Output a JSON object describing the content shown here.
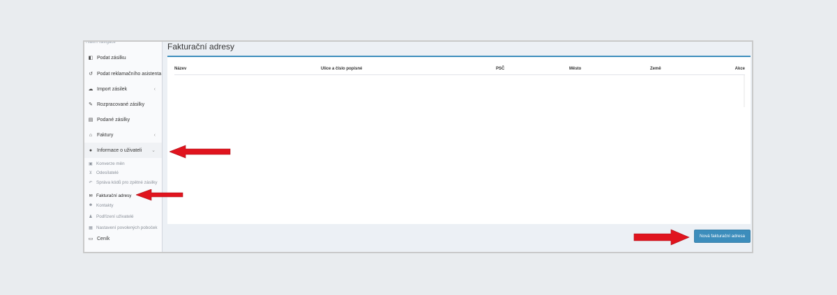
{
  "sidebar": {
    "nav_header": "Hlavní navigace",
    "items": [
      {
        "label": "Podat zásilku",
        "icon": "box-icon"
      },
      {
        "label": "Podat reklamačního asistenta",
        "icon": "undo-icon"
      },
      {
        "label": "Import zásilek",
        "icon": "cloud-upload-icon",
        "chevron": "‹"
      },
      {
        "label": "Rozpracované zásilky",
        "icon": "edit-icon"
      },
      {
        "label": "Podané zásilky",
        "icon": "inbox-icon"
      },
      {
        "label": "Faktury",
        "icon": "bank-icon",
        "chevron": "‹"
      },
      {
        "label": "Informace o uživateli",
        "icon": "user-icon",
        "chevron": "⌄"
      }
    ],
    "sub_items": [
      {
        "label": "Konverze měn",
        "icon": "money-icon"
      },
      {
        "label": "Odesílatelé",
        "icon": "cart-icon"
      },
      {
        "label": "Správa kódů pro zpětné zásilky",
        "icon": "reply-icon"
      },
      {
        "label": "Fakturační adresy",
        "icon": "envelope-icon"
      },
      {
        "label": "Kontakty",
        "icon": "users-icon"
      },
      {
        "label": "Podřízení uživatelé",
        "icon": "person-icon"
      },
      {
        "label": "Nastavení povolených poboček",
        "icon": "grid-icon"
      }
    ],
    "last_item": {
      "label": "Ceník",
      "icon": "credit-card-icon"
    }
  },
  "main": {
    "title": "Fakturační adresy",
    "table_headers": [
      "Název",
      "Ulice a číslo popisné",
      "PSČ",
      "Město",
      "Země",
      "Akce"
    ],
    "new_button_label": "Nová fakturační adresa"
  },
  "colors": {
    "accent": "#3c8dbc",
    "arrow": "#e0141e"
  }
}
